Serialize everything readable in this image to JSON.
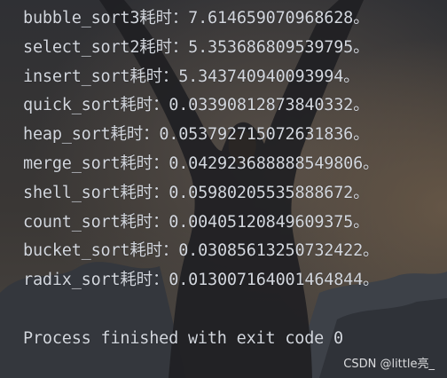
{
  "console": {
    "lines": [
      "bubble_sort3耗时：7.614659070968628。",
      "select_sort2耗时：5.353686809539795。",
      "insert_sort耗时：5.343740940093994。",
      "quick_sort耗时：0.03390812873840332。",
      "heap_sort耗时：0.05379271507263183б。",
      "merge_sort耗时：0.04292368888854980б。",
      "shell_sort耗时：0.05980205535888672。",
      "count_sort耗时：0.00405120849609375。",
      "bucket_sort耗时：0.03085613250732422。",
      "radix_sort耗时：0.01300716400146484​4。"
    ],
    "exit_message": "Process finished with exit code 0"
  },
  "watermark": "CSDN @little亮_",
  "colors": {
    "console_text": "#d3d7de",
    "background": "#2b2d31"
  }
}
